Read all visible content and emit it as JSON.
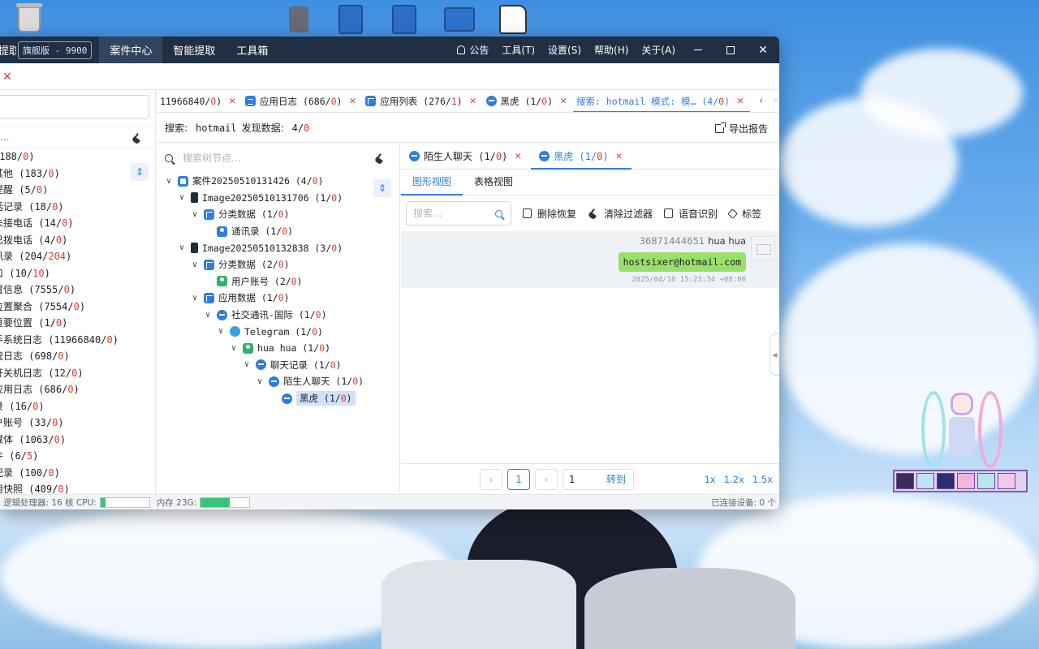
{
  "window": {
    "app_name": "提取系统",
    "edition": "旗舰版 - 9900",
    "menu_main": [
      "案件中心",
      "智能提取",
      "工具箱"
    ],
    "menu_right": [
      "公告",
      "工具(T)",
      "设置(S)",
      "帮助(H)",
      "关于(A)"
    ]
  },
  "left_panel": {
    "filter_placeholder": "...",
    "items": [
      {
        "label": "(188/",
        "red": "0",
        "end": ")"
      },
      {
        "label": "其他 (183/",
        "red": "0",
        "end": ")"
      },
      {
        "label": "提醒 (5/",
        "red": "0",
        "end": ")"
      },
      {
        "label": "话记录 (18/",
        "red": "0",
        "end": ")"
      },
      {
        "label": "未接电话 (14/",
        "red": "0",
        "end": ")"
      },
      {
        "label": "已拨电话 (4/",
        "red": "0",
        "end": ")"
      },
      {
        "label": "讯录 (204/",
        "red": "204",
        "end": ")"
      },
      {
        "label": "口 (10/",
        "red": "10",
        "end": ")"
      },
      {
        "label": "置信息 (7555/",
        "red": "0",
        "end": ")"
      },
      {
        "label": "位置聚合 (7554/",
        "red": "0",
        "end": ")"
      },
      {
        "label": "重要位置 (1/",
        "red": "0",
        "end": ")"
      },
      {
        "label": "手系统日志 (11966840/",
        "red": "0",
        "end": ")"
      },
      {
        "label": "统日志 (698/",
        "red": "0",
        "end": ")"
      },
      {
        "label": "开关机日志 (12/",
        "red": "0",
        "end": ")"
      },
      {
        "label": "应用日志 (686/",
        "red": "0",
        "end": ")"
      },
      {
        "label": "录 (16/",
        "red": "0",
        "end": ")"
      },
      {
        "label": "户账号 (33/",
        "red": "0",
        "end": ")"
      },
      {
        "label": "媒体 (1063/",
        "red": "0",
        "end": ")"
      },
      {
        "label": "件 (6/",
        "red": "5",
        "end": ")"
      },
      {
        "label": "记录 (100/",
        "red": "0",
        "end": ")"
      },
      {
        "label": "用快照 (409/",
        "red": "0",
        "end": ")"
      }
    ]
  },
  "top_tabs": [
    {
      "label": "11966840/",
      "red": "0",
      "end": ")",
      "icon": "none"
    },
    {
      "label": "应用日志 (686/",
      "red": "0",
      "end": ")",
      "icon": "doc-icon"
    },
    {
      "label": "应用列表 (276/",
      "red": "1",
      "end": ")",
      "icon": "grid-icon"
    },
    {
      "label": "黑虎 (1/",
      "red": "0",
      "end": ")",
      "icon": "chat-icon"
    },
    {
      "label": "搜索: hotmail 模式: 模… (4/",
      "red": "0",
      "end": ")",
      "icon": "none",
      "active": true
    }
  ],
  "search_summary": {
    "prefix": "搜索:",
    "keyword": "hotmail",
    "found_label": "发现数据:",
    "count_main": "4/",
    "count_red": "0",
    "export_label": "导出报告"
  },
  "tree": {
    "search_placeholder": "搜索树节点...",
    "nodes": [
      {
        "level": 0,
        "chev": "v",
        "icon": "case-icon",
        "label": "案件20250510131426 (4/",
        "red": "0",
        "end": ")"
      },
      {
        "level": 1,
        "chev": "v",
        "icon": "phone-icon",
        "label": "Image20250510131706 (1/",
        "red": "0",
        "end": ")"
      },
      {
        "level": 2,
        "chev": "v",
        "icon": "grid-icon",
        "label": "分类数据 (1/",
        "red": "0",
        "end": ")"
      },
      {
        "level": 3,
        "chev": "",
        "icon": "user-icon",
        "label": "通讯录 (1/",
        "red": "0",
        "end": ")"
      },
      {
        "level": 1,
        "chev": "v",
        "icon": "phone-icon",
        "label": "Image20250510132838 (3/",
        "red": "0",
        "end": ")"
      },
      {
        "level": 2,
        "chev": "v",
        "icon": "grid-icon",
        "label": "分类数据 (2/",
        "red": "0",
        "end": ")"
      },
      {
        "level": 3,
        "chev": "",
        "icon": "user-green-icon",
        "label": "用户账号 (2/",
        "red": "0",
        "end": ")"
      },
      {
        "level": 2,
        "chev": "v",
        "icon": "grid-icon",
        "label": "应用数据 (1/",
        "red": "0",
        "end": ")"
      },
      {
        "level": 3,
        "chev": "v",
        "icon": "chat-icon",
        "label": "社交通讯-国际 (1/",
        "red": "0",
        "end": ")"
      },
      {
        "level": 4,
        "chev": "v",
        "icon": "telegram-icon",
        "label": "Telegram (1/",
        "red": "0",
        "end": ")"
      },
      {
        "level": 5,
        "chev": "v",
        "icon": "user-green-icon",
        "label": "hua hua (1/",
        "red": "0",
        "end": ")"
      },
      {
        "level": 6,
        "chev": "v",
        "icon": "chat-icon",
        "label": "聊天记录 (1/",
        "red": "0",
        "end": ")"
      },
      {
        "level": 7,
        "chev": "v",
        "icon": "chat-icon",
        "label": "陌生人聊天 (1/",
        "red": "0",
        "end": ")"
      },
      {
        "level": 8,
        "chev": "",
        "icon": "chat-icon",
        "label": "黑虎 (1/",
        "red": "0",
        "end": ")",
        "selected": true
      }
    ]
  },
  "sub_tabs": [
    {
      "label": "陌生人聊天 (1/",
      "red": "0",
      "end": ")"
    },
    {
      "label": "黑虎 (1/",
      "red": "0",
      "end": ")",
      "active": true
    }
  ],
  "view_tabs": [
    "图形视图",
    "表格视图"
  ],
  "toolbar": {
    "search_placeholder": "搜索...",
    "buttons": [
      "删除恢复",
      "清除过滤器",
      "语音识别",
      "标签"
    ]
  },
  "message": {
    "sender_id": "36871444651",
    "sender_name": "hua hua",
    "text": "hostsixer@hotmail.com",
    "time": "2025/04/18 15:23:34 +08:00"
  },
  "pager": {
    "current": "1",
    "goto_value": "1",
    "goto_label": "转到",
    "zoom": [
      "1x",
      "1.2x",
      "1.5x"
    ]
  },
  "status": {
    "cpu_label": "逻辑处理器: 16 核 CPU:",
    "cpu_fraction": 0.1,
    "mem_label": "内存 23G:",
    "mem_fraction": 0.6,
    "devices": "已连接设备: 0 个"
  },
  "colors": {
    "accent": "#2f7de1",
    "titlebar": "#212f45",
    "red": "#e53935",
    "bubble": "#98e06a"
  }
}
